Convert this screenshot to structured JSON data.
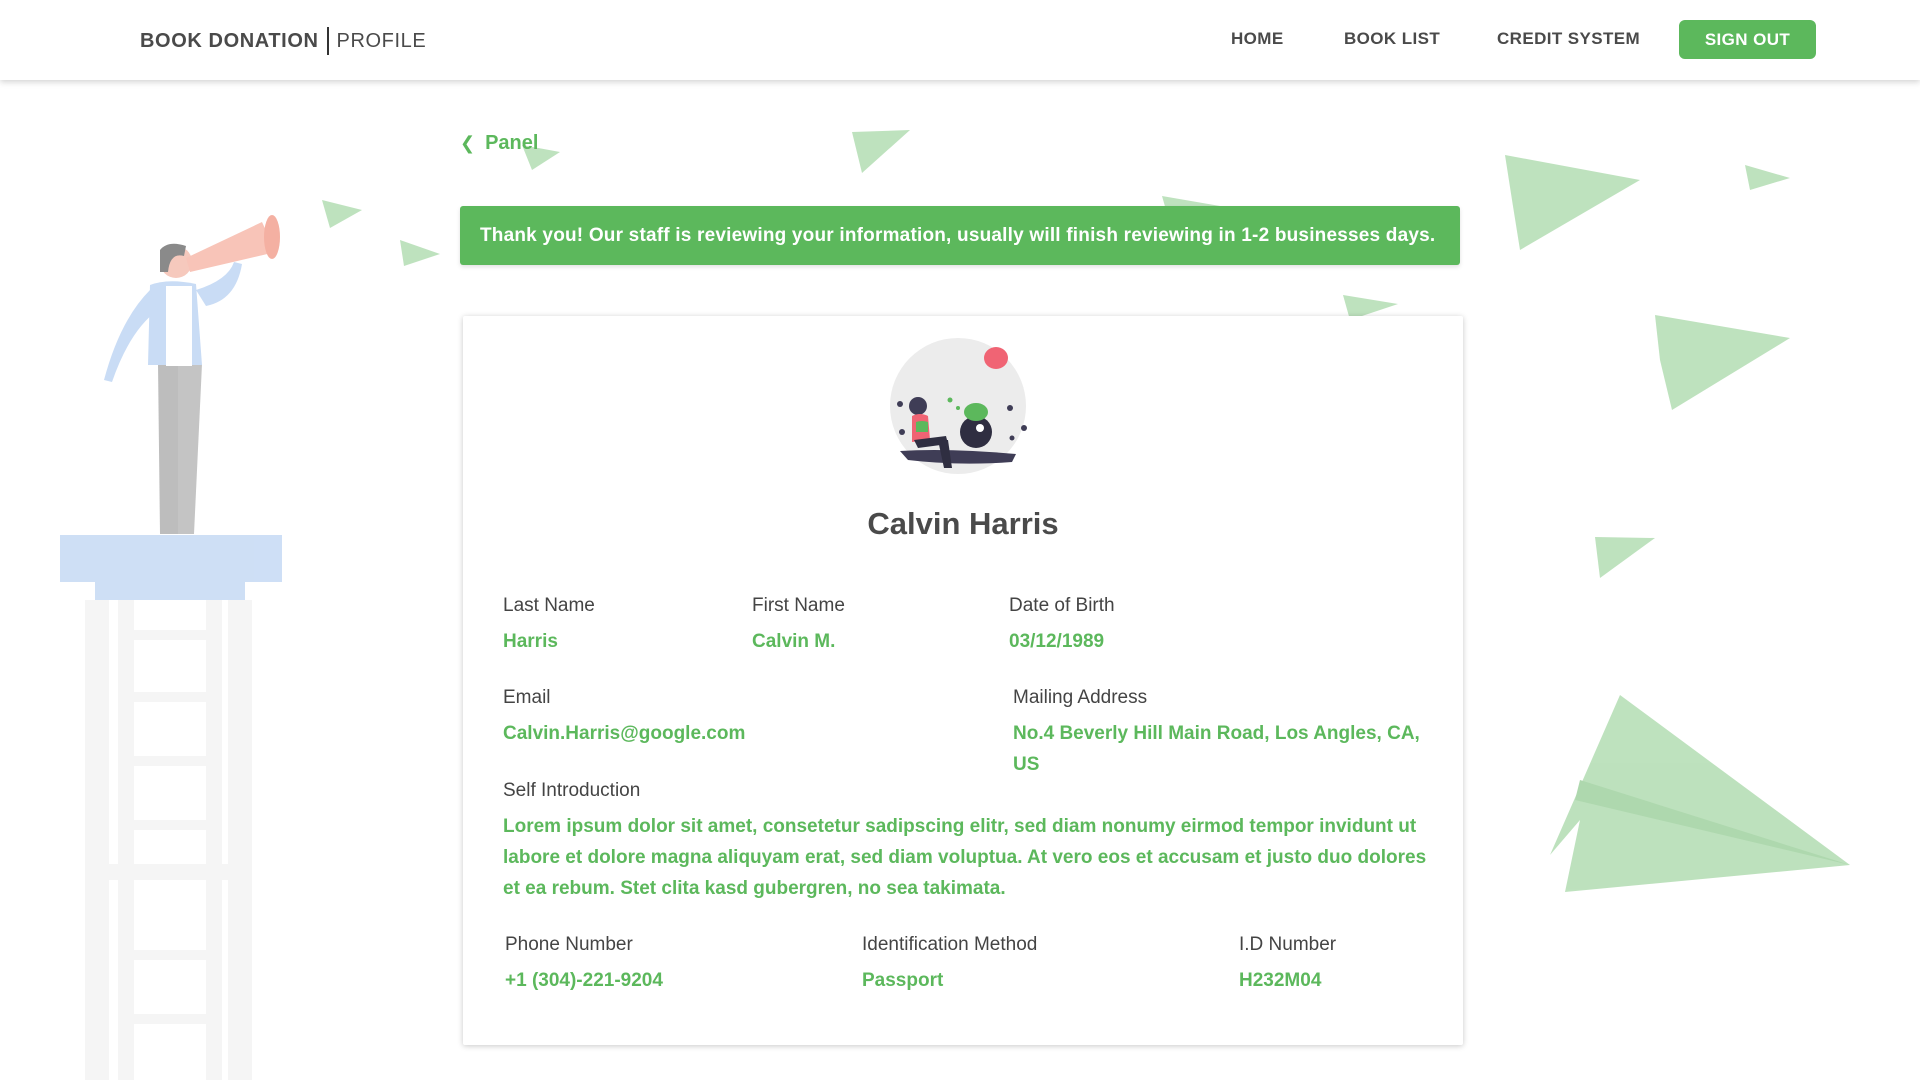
{
  "header": {
    "brand": "BOOK DONATION",
    "section": "PROFILE",
    "nav": [
      "HOME",
      "BOOK LIST",
      "CREDIT SYSTEM"
    ],
    "sign_out": "SIGN OUT"
  },
  "back_link": "Panel",
  "alert": "Thank you! Our staff is reviewing your information, usually will finish reviewing in 1-2 businesses days.",
  "profile": {
    "full_name": "Calvin Harris",
    "fields": {
      "last_name": {
        "label": "Last Name",
        "value": "Harris"
      },
      "first_name": {
        "label": "First Name",
        "value": "Calvin M."
      },
      "dob": {
        "label": "Date of Birth",
        "value": "03/12/1989"
      },
      "email": {
        "label": "Email",
        "value": "Calvin.Harris@google.com"
      },
      "address": {
        "label": "Mailing Address",
        "value": "No.4 Beverly Hill Main Road, Los Angles, CA, US"
      },
      "intro": {
        "label": "Self Introduction",
        "value": "Lorem ipsum dolor sit amet, consetetur sadipscing elitr, sed diam nonumy eirmod tempor invidunt ut labore et dolore magna aliquyam erat, sed diam voluptua. At vero eos et accusam et justo duo dolores et ea rebum. Stet clita kasd gubergren, no sea takimata."
      },
      "phone": {
        "label": "Phone Number",
        "value": "+1 (304)-221-9204"
      },
      "id_method": {
        "label": "Identification Method",
        "value": "Passport"
      },
      "id_number": {
        "label": "I.D Number",
        "value": "H232M04"
      }
    }
  },
  "colors": {
    "accent": "#5cb85c",
    "text": "#444444"
  }
}
